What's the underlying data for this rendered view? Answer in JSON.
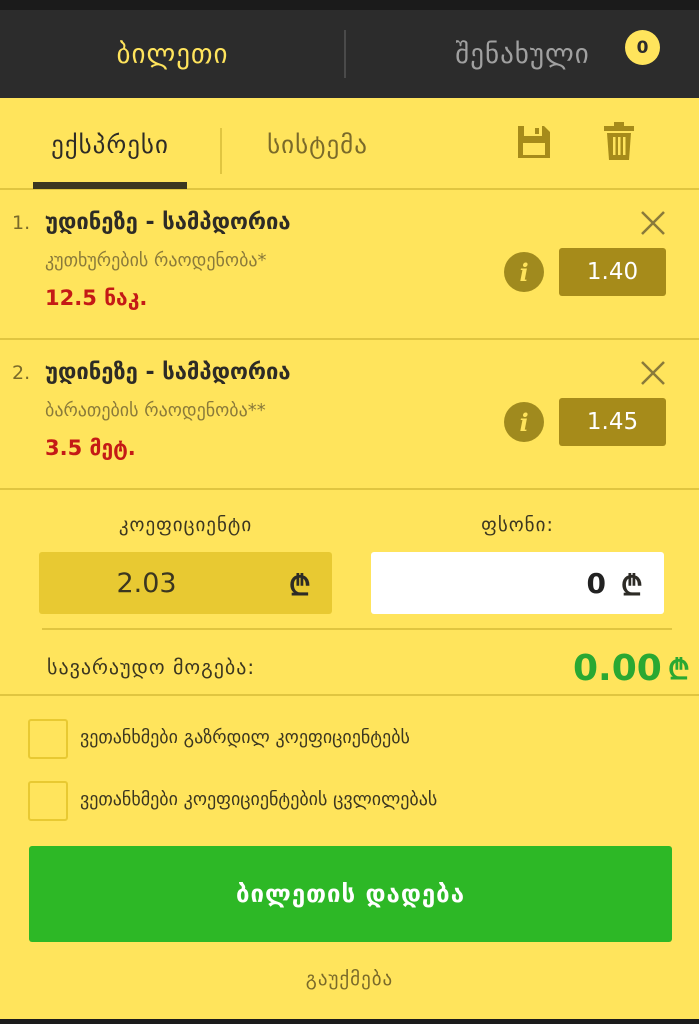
{
  "header": {
    "ticket_tab": "ბილეთი",
    "saved_tab": "შენახული",
    "saved_count": "0"
  },
  "modes": {
    "express": "ექსპრესი",
    "system": "სისტემა"
  },
  "bets": [
    {
      "number": "1.",
      "match": "უდინეზე - სამპდორია",
      "market": "კუთხურების რაოდენობა*",
      "outcome": "12.5 ნაკ.",
      "odd": "1.40",
      "info": "i"
    },
    {
      "number": "2.",
      "match": "უდინეზე - სამპდორია",
      "market": "ბარათების რაოდენობა**",
      "outcome": "3.5 მეტ.",
      "odd": "1.45",
      "info": "i"
    }
  ],
  "summary": {
    "coef_label": "კოეფიციენტი",
    "coef_value": "2.03",
    "stake_label": "ფსონი:",
    "stake_value": "0",
    "currency": "₾",
    "win_label": "სავარაუდო მოგება:",
    "win_value": "0.00"
  },
  "checks": [
    "ვეთანხმები გაზრდილ კოეფიციენტებს",
    "ვეთანხმები კოეფიციენტების ცვლილებას"
  ],
  "actions": {
    "place": "ბილეთის დადება",
    "cancel": "გაუქმება"
  },
  "colors": {
    "background": "#ffe45c",
    "header": "#2c2c2c",
    "accent_green": "#2db826",
    "outcome_red": "#c41a16",
    "odd_box": "#a68b1a"
  },
  "icons": {
    "save": "save-icon",
    "trash": "trash-icon",
    "close": "close-icon",
    "info": "info-icon",
    "currency": "lari-icon"
  }
}
